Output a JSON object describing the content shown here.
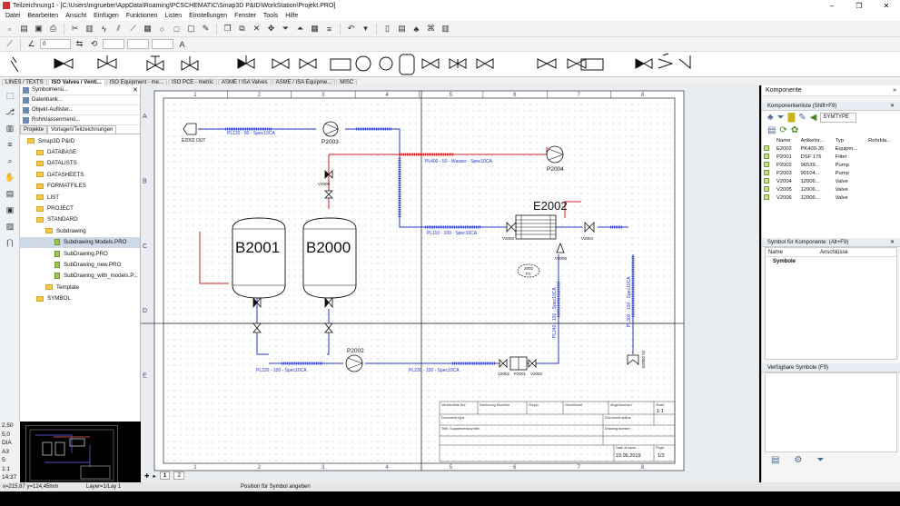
{
  "window": {
    "title": "Teilzeichnung1 - [C:\\Users\\mgrueber\\AppData\\Roaming\\PCSCHEMATIC\\Smap3D P&ID\\WorkStation\\Projekt.PRO]",
    "controls": [
      "–",
      "❐",
      "✕"
    ]
  },
  "menu": [
    "Datei",
    "Bearbeiten",
    "Ansicht",
    "Einfügen",
    "Funktionen",
    "Listen",
    "Einstellungen",
    "Fenster",
    "Tools",
    "Hilfe"
  ],
  "toolbar2": {
    "combo_value": "0"
  },
  "symbol_tabs": [
    {
      "label": "LINES / TEXTS",
      "active": false
    },
    {
      "label": "ISO Valves / Venti...",
      "active": true
    },
    {
      "label": "ISO Equipment - me...",
      "active": false
    },
    {
      "label": "ISO PCE - metric",
      "active": false
    },
    {
      "label": "ASME / ISA Valves",
      "active": false
    },
    {
      "label": "ASME / ISA Equipme...",
      "active": false
    },
    {
      "label": "MISC",
      "active": false
    }
  ],
  "left_panel": {
    "buttons": [
      "Symbolmenü...",
      "Datenbank...",
      "Objekt-Auflister...",
      "Rohrklassenmenü..."
    ],
    "tabs": [
      {
        "label": "Projekte",
        "active": false
      },
      {
        "label": "Vorlagen/Teilzeichnungen",
        "active": true
      }
    ],
    "tree": [
      {
        "label": "Smap3D P&ID",
        "indent": 0,
        "type": "folder"
      },
      {
        "label": "DATABASE",
        "indent": 1,
        "type": "folder"
      },
      {
        "label": "DATALISTS",
        "indent": 1,
        "type": "folder"
      },
      {
        "label": "DATASHEETS",
        "indent": 1,
        "type": "folder"
      },
      {
        "label": "FORMATFILES",
        "indent": 1,
        "type": "folder"
      },
      {
        "label": "LIST",
        "indent": 1,
        "type": "folder"
      },
      {
        "label": "PROJECT",
        "indent": 1,
        "type": "folder"
      },
      {
        "label": "STANDARD",
        "indent": 1,
        "type": "folder"
      },
      {
        "label": "Subdrawing",
        "indent": 2,
        "type": "folder"
      },
      {
        "label": "Subdrawing Models.PRO",
        "indent": 3,
        "type": "file",
        "selected": true
      },
      {
        "label": "SubDrawing.PRO",
        "indent": 3,
        "type": "file"
      },
      {
        "label": "SubDrawing_new.PRO",
        "indent": 3,
        "type": "file"
      },
      {
        "label": "SubDrawing_with_models.P...",
        "indent": 3,
        "type": "file"
      },
      {
        "label": "Template",
        "indent": 2,
        "type": "folder"
      },
      {
        "label": "SYMBOL",
        "indent": 1,
        "type": "folder"
      }
    ]
  },
  "left_info": [
    "2,50",
    "5,0",
    "DIA",
    "A3",
    "5:",
    "1:1",
    "14:37"
  ],
  "drawing": {
    "col_labels": [
      "1",
      "2",
      "3",
      "4",
      "5",
      "6",
      "7",
      "8"
    ],
    "row_labels": [
      "A",
      "B",
      "C",
      "D",
      "E"
    ],
    "tanks": [
      "B2001",
      "B2000"
    ],
    "exchanger": "E2002",
    "pumps": [
      "P2003",
      "P2004",
      "P2002"
    ],
    "filter": "P2001",
    "valves": [
      "V2003",
      "V2004",
      "V2005",
      "V2006",
      "V2002",
      "V2001"
    ],
    "pipes": [
      "PL120 - 80 - Spec10CA",
      "PL400 - 50 - Wasser - Spec10CA",
      "PL110 - 100 - Spec10CA",
      "PL220 - 100 - Spec10CA",
      "PL230 - 100 - Spec10CA",
      "PL240 - 100 - Spec10CA",
      "PL300 - 100 - Spec10CA"
    ],
    "outlet_label": "E2002 OUT",
    "inlet_label": "E2002 IN",
    "fc_label": "FC",
    "fc_number": "2002",
    "title_block": {
      "headers": [
        "Verwendete Anl.",
        "Zeichnung Nummer",
        "Grupp.",
        "Gezeichnet",
        "Abgenommen",
        "Scale"
      ],
      "scale_value": "1:1",
      "document_type_label": "Document type",
      "document_status_label": "Document status",
      "title_label": "Title, Supplementary title",
      "drawing_number_label": "Drawing number",
      "date_label": "Date of issue",
      "date_value": "19.06.2019",
      "page_label": "Page",
      "page_value": "1/2"
    }
  },
  "page_tabs": [
    "1",
    "2"
  ],
  "right_panel": {
    "title": "Komponente",
    "list_title": "Komponentenliste (Shift+F9)",
    "symtype_label": "SYMTYPE",
    "columns": [
      "Name",
      "Artikelnr...",
      "Typ",
      "Rohrkla..."
    ],
    "rows": [
      {
        "name": "E2002",
        "art": "PK400-35",
        "typ": "Equipm..."
      },
      {
        "name": "P2001",
        "art": "DSF 176",
        "typ": "Filter"
      },
      {
        "name": "P2002",
        "art": "96539...",
        "typ": "Pump"
      },
      {
        "name": "P2003",
        "art": "99104...",
        "typ": "Pump"
      },
      {
        "name": "V2004",
        "art": "12006...",
        "typ": "Valve"
      },
      {
        "name": "V2005",
        "art": "12006...",
        "typ": "Valve"
      },
      {
        "name": "V2006",
        "art": "12006...",
        "typ": "Valve"
      }
    ],
    "symbol_title": "Symbol für Komponente: (Alt+F9)",
    "symbol_columns": [
      "Name",
      "Anschlüsse"
    ],
    "symbol_group": "Symbole",
    "avail_title": "Verfügbare Symbole (F9)"
  },
  "status": {
    "coords": "x=215,87 y=124,45mm",
    "layer": "Layer=1/Lay 1",
    "hint": "Position für Symbol angeben"
  }
}
